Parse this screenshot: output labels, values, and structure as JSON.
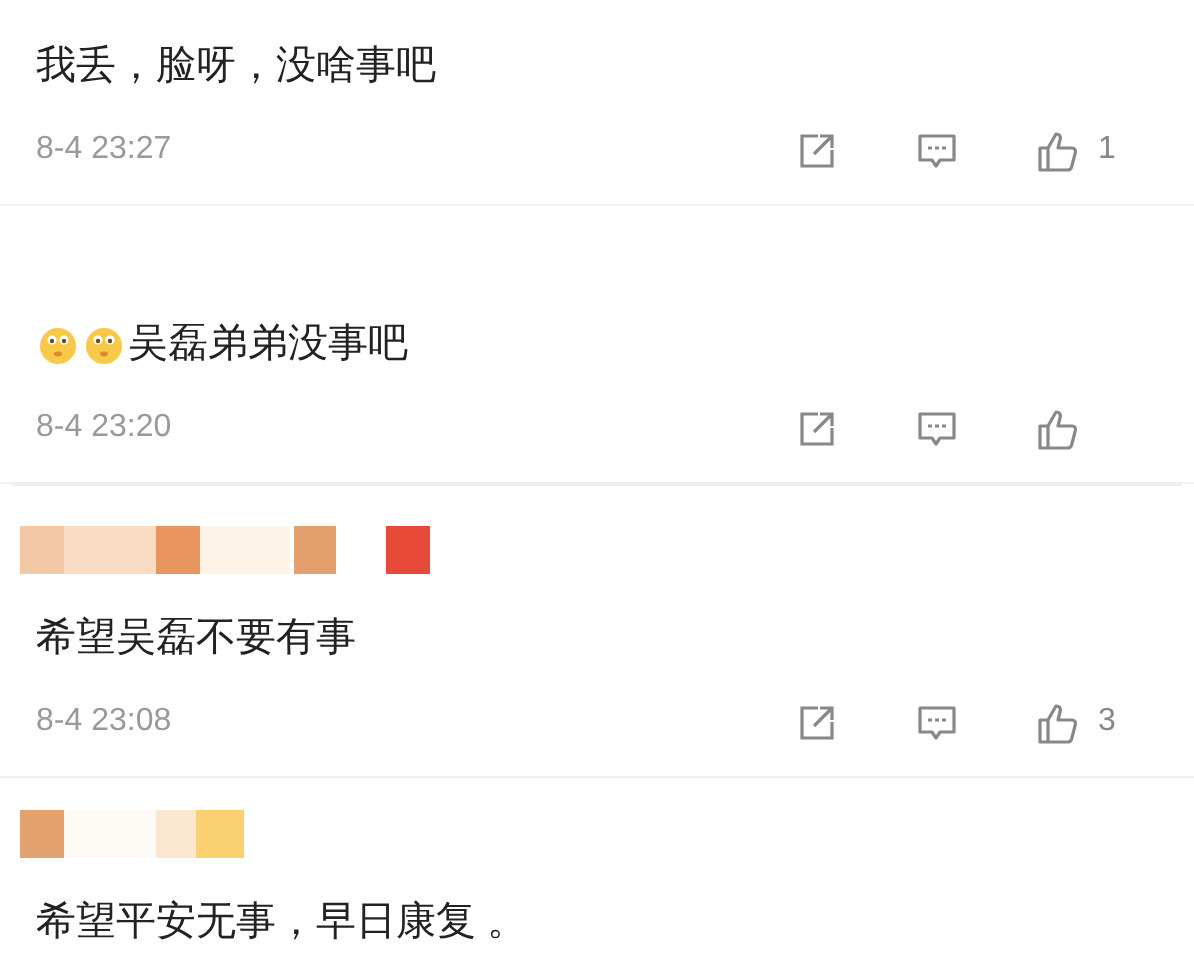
{
  "comments": [
    {
      "text": "我丢，脸呀，没啥事吧",
      "time": "8-4 23:27",
      "likes": "1"
    },
    {
      "emojis": [
        {
          "kind": "face"
        },
        {
          "kind": "face"
        }
      ],
      "text": "吴磊弟弟没事吧",
      "time": "8-4 23:20"
    },
    {
      "username": {
        "kind": "pixelated"
      },
      "text": "希望吴磊不要有事",
      "time": "8-4 23:08",
      "likes": "3"
    },
    {
      "username": {
        "kind": "pixelated"
      },
      "text": "希望平安无事，早日康复 。"
    }
  ]
}
